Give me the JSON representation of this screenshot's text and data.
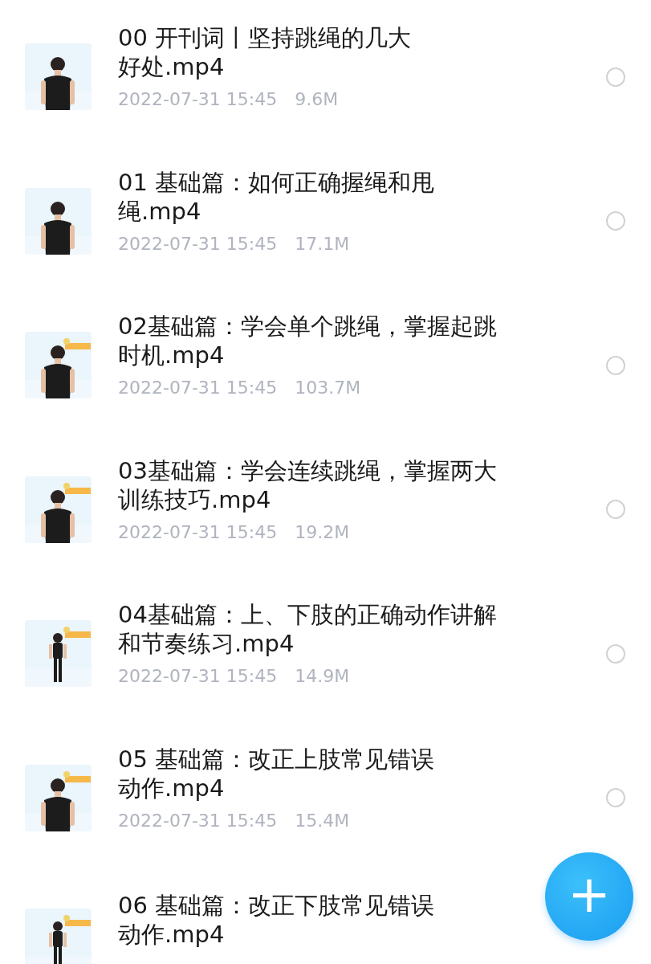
{
  "files": [
    {
      "title_lines": [
        "00 开刊词丨坚持跳绳的几大",
        "好处.mp4"
      ],
      "date": "2022-07-31 15:45",
      "size": "9.6M",
      "selected": false
    },
    {
      "title_lines": [
        "01 基础篇：如何正确握绳和甩",
        "绳.mp4"
      ],
      "date": "2022-07-31 15:45",
      "size": "17.1M",
      "selected": false
    },
    {
      "title_lines": [
        "02基础篇：学会单个跳绳，掌握起跳",
        "时机.mp4"
      ],
      "date": "2022-07-31 15:45",
      "size": "103.7M",
      "selected": false
    },
    {
      "title_lines": [
        "03基础篇：学会连续跳绳，掌握两大",
        "训练技巧.mp4"
      ],
      "date": "2022-07-31 15:45",
      "size": "19.2M",
      "selected": false
    },
    {
      "title_lines": [
        "04基础篇：上、下肢的正确动作讲解",
        "和节奏练习.mp4"
      ],
      "date": "2022-07-31 15:45",
      "size": "14.9M",
      "selected": false
    },
    {
      "title_lines": [
        "05 基础篇：改正上肢常见错误",
        "动作.mp4"
      ],
      "date": "2022-07-31 15:45",
      "size": "15.4M",
      "selected": false
    },
    {
      "title_lines": [
        "06 基础篇：改正下肢常见错误",
        "动作.mp4"
      ]
    }
  ],
  "add_button": {
    "icon": "+"
  }
}
